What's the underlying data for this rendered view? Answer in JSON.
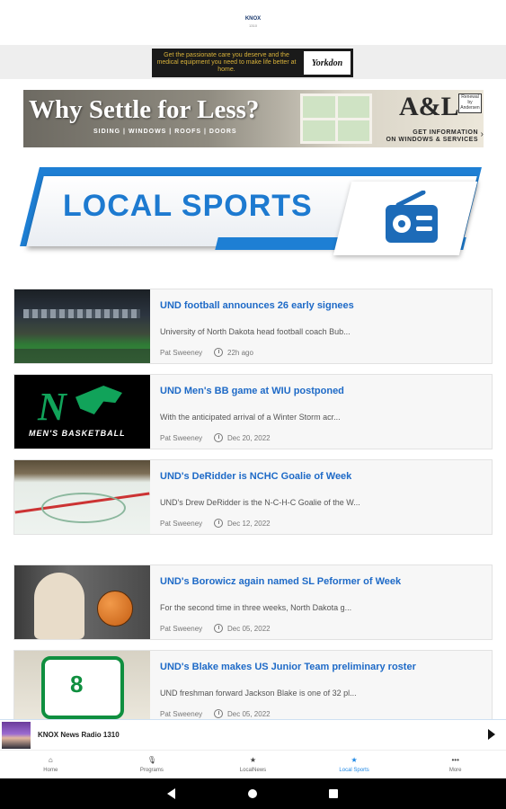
{
  "header": {
    "logo_text": "KNOX",
    "logo_sub": "1310"
  },
  "ad_small": {
    "text": "Get the passionate care you deserve and the medical equipment you need to make life better at home.",
    "brand": "Yorkdon"
  },
  "ad_big": {
    "headline": "Why Settle for Less?",
    "subline": "SIDING | WINDOWS | ROOFS | DOORS",
    "brandmark": "A&L",
    "renewal": "Renewal by Andersen",
    "info_line1": "GET INFORMATION",
    "info_line2": "ON WINDOWS & SERVICES"
  },
  "banner": {
    "title": "LOCAL SPORTS"
  },
  "news": [
    {
      "headline": "UND football announces 26 early signees",
      "summary": "University of North Dakota head football coach Bub...",
      "author": "Pat Sweeney",
      "date": "22h ago"
    },
    {
      "headline": "UND Men's BB game at WIU postponed",
      "summary": "With the anticipated arrival of a Winter Storm acr...",
      "author": "Pat Sweeney",
      "date": "Dec 20, 2022",
      "thumb_caption": "MEN'S BASKETBALL"
    },
    {
      "headline": "UND's DeRidder is NCHC Goalie of Week",
      "summary": "UND's Drew DeRidder is the N-C-H-C Goalie of the W...",
      "author": "Pat Sweeney",
      "date": "Dec 12, 2022"
    },
    {
      "headline": "UND's Borowicz again named SL Peformer of Week",
      "summary": "For the second time in three weeks, North Dakota g...",
      "author": "Pat Sweeney",
      "date": "Dec 05, 2022"
    },
    {
      "headline": "UND's Blake makes US Junior Team preliminary roster",
      "summary": "UND freshman forward Jackson Blake is one of 32 pl...",
      "author": "Pat Sweeney",
      "date": "Dec 05, 2022",
      "thumb_number": "8"
    }
  ],
  "player": {
    "station": "KNOX News Radio 1310"
  },
  "nav": [
    {
      "icon": "home-icon",
      "glyph": "⌂",
      "label": "Home"
    },
    {
      "icon": "microphone-icon",
      "glyph": "🎙",
      "label": "Programs"
    },
    {
      "icon": "star-icon",
      "glyph": "★",
      "label": "LocalNews"
    },
    {
      "icon": "star-icon",
      "glyph": "★",
      "label": "Local Sports"
    },
    {
      "icon": "more-icon",
      "glyph": "•••",
      "label": "More"
    }
  ],
  "colors": {
    "accent": "#1e88e5",
    "headline": "#1e6ac7",
    "banner_blue": "#1e7fd4",
    "und_green": "#11a35a"
  }
}
